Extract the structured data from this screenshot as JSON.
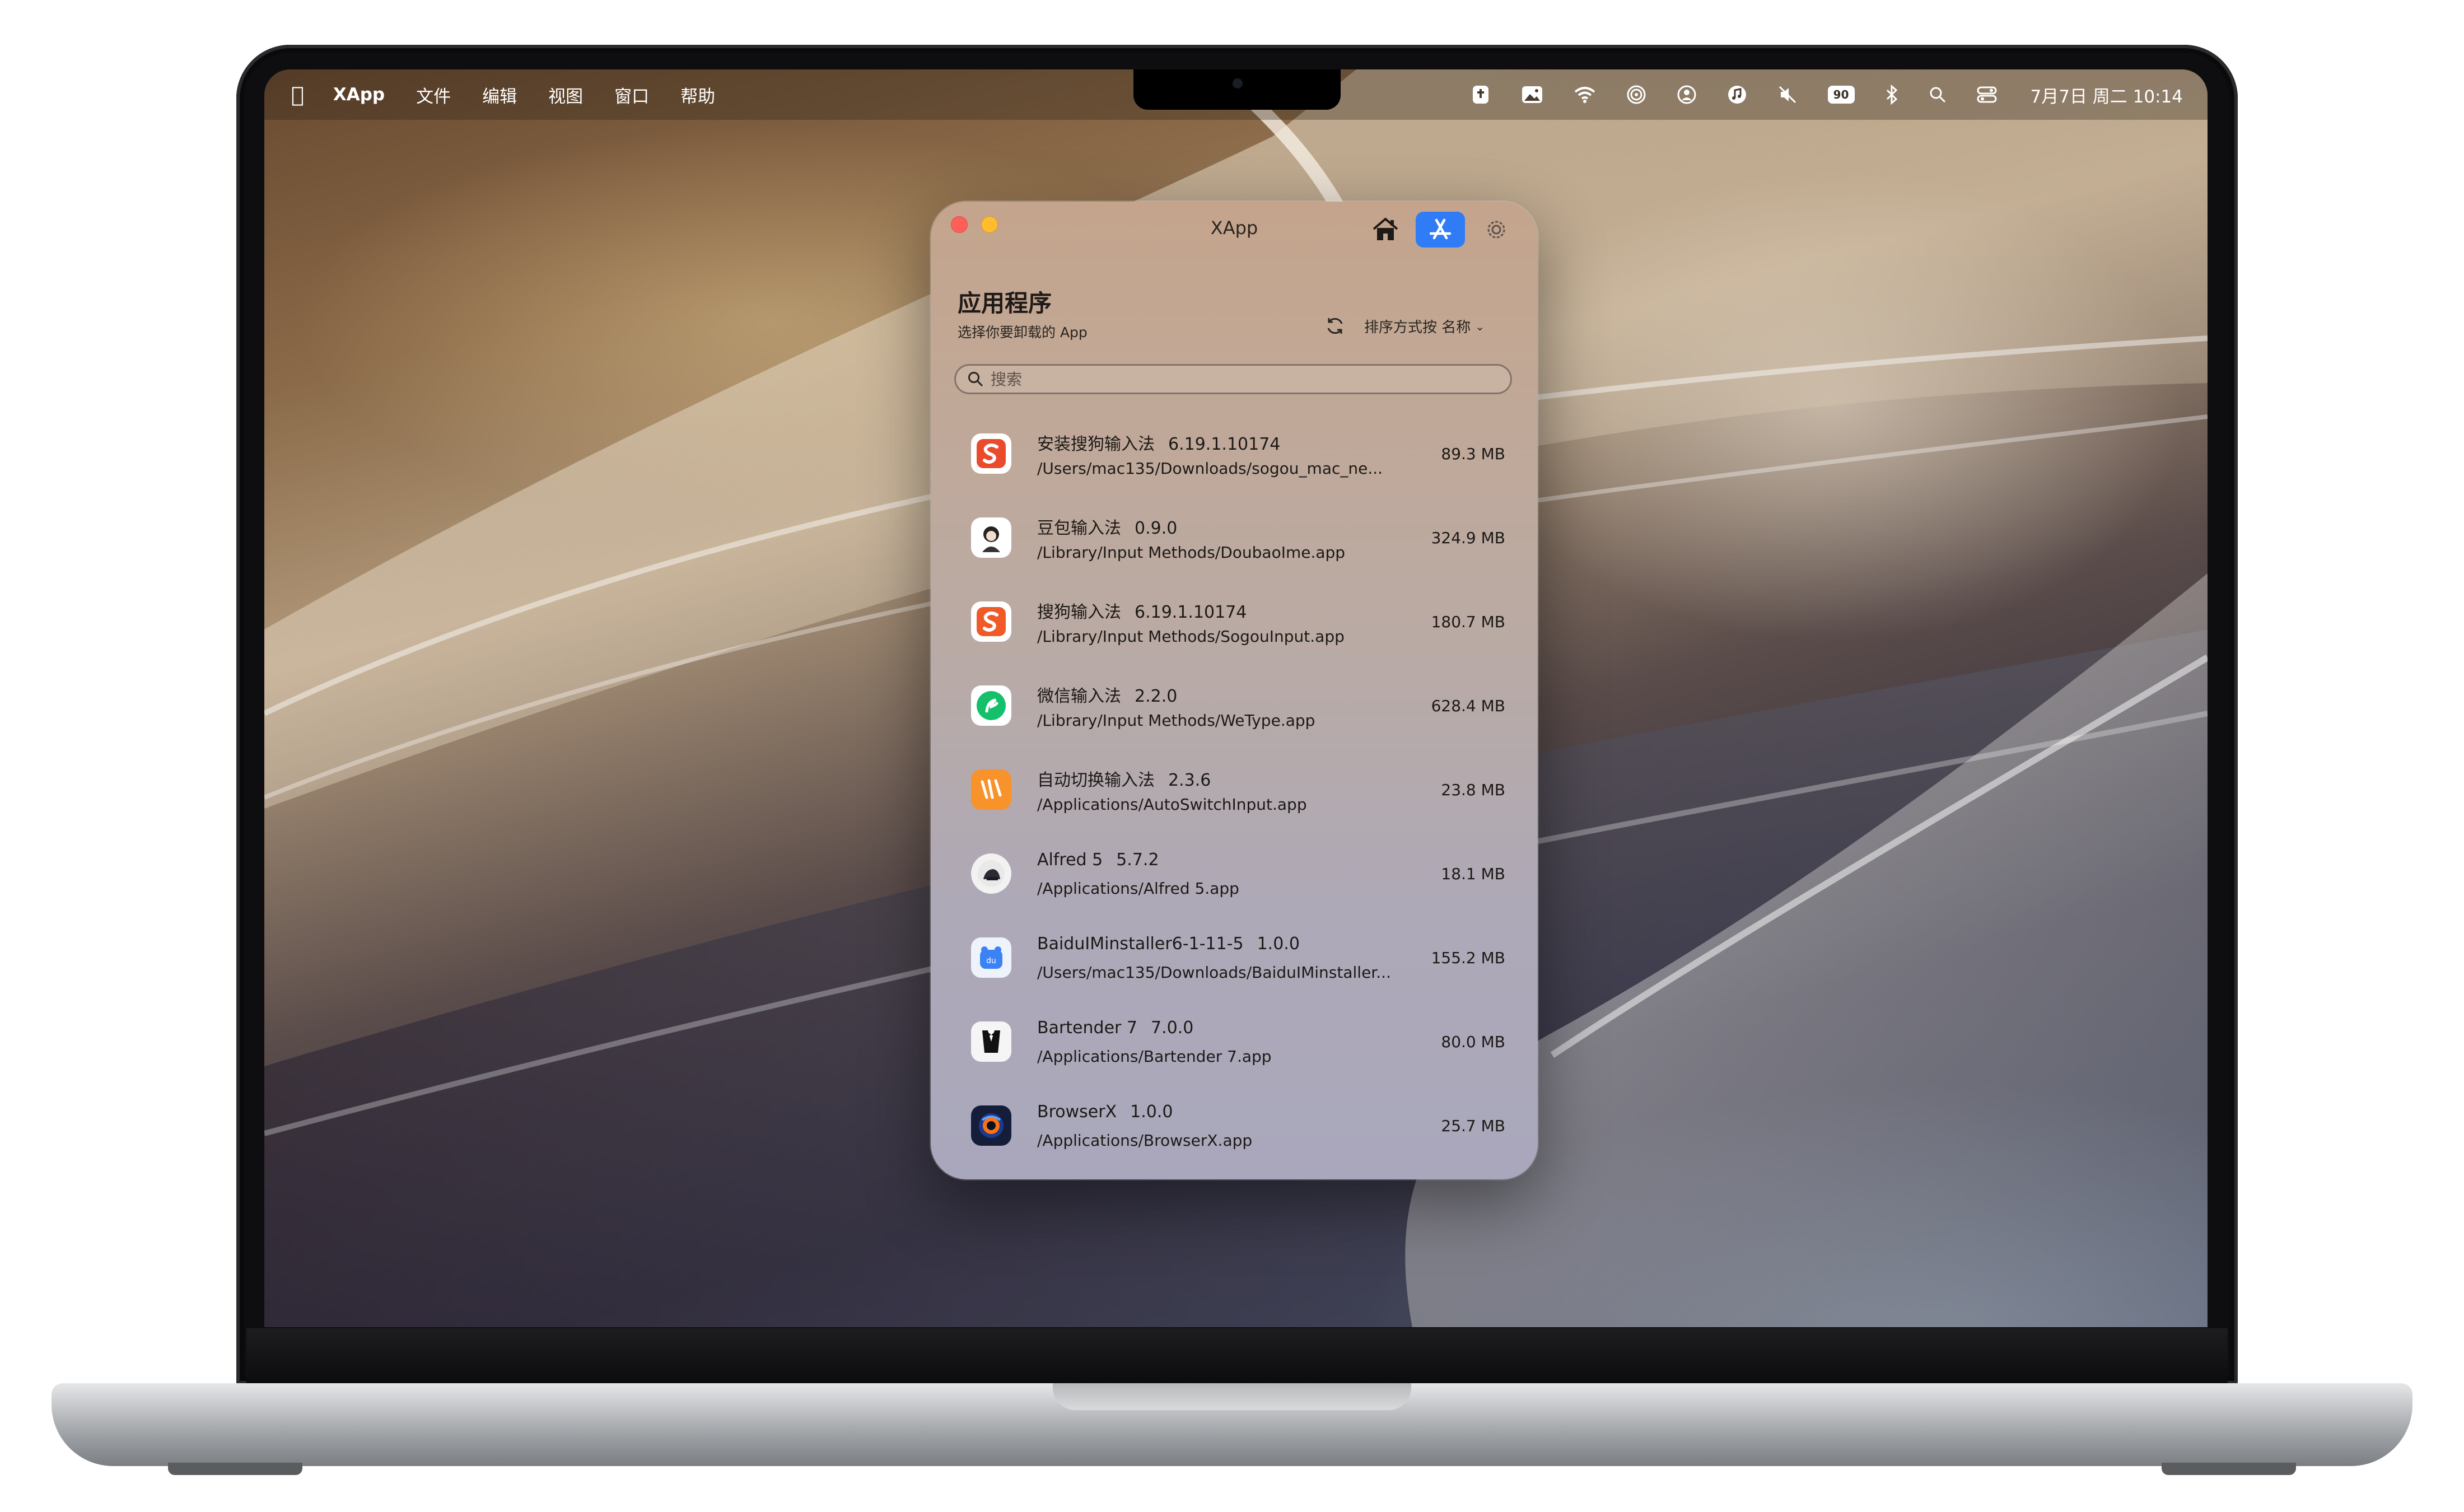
{
  "menubar": {
    "app_name": "XApp",
    "menus": [
      "文件",
      "编辑",
      "视图",
      "窗口",
      "帮助"
    ],
    "battery": "90",
    "clock": "7月7日 周二  10:14"
  },
  "window": {
    "title": "XApp",
    "section_title": "应用程序",
    "section_subtitle": "选择你要卸载的 App",
    "sort_label": "排序方式按 名称",
    "search_placeholder": "搜索"
  },
  "apps": [
    {
      "name": "安装搜狗输入法",
      "version": "6.19.1.10174",
      "path": "/Users/mac135/Downloads/sogou_mac_ne...",
      "size": "89.3 MB",
      "icon": "sogou-install-icon",
      "color": "#ea4b2c"
    },
    {
      "name": "豆包输入法",
      "version": "0.9.0",
      "path": "/Library/Input Methods/DoubaoIme.app",
      "size": "324.9 MB",
      "icon": "doubao-icon",
      "color": "#ffffff"
    },
    {
      "name": "搜狗输入法",
      "version": "6.19.1.10174",
      "path": "/Library/Input Methods/SogouInput.app",
      "size": "180.7 MB",
      "icon": "sogou-icon",
      "color": "#f05a28"
    },
    {
      "name": "微信输入法",
      "version": "2.2.0",
      "path": "/Library/Input Methods/WeType.app",
      "size": "628.4 MB",
      "icon": "wetype-icon",
      "color": "#15c06b"
    },
    {
      "name": "自动切换输入法",
      "version": "2.3.6",
      "path": "/Applications/AutoSwitchInput.app",
      "size": "23.8 MB",
      "icon": "autoswitch-icon",
      "color": "#f8922a"
    },
    {
      "name": "Alfred 5",
      "version": "5.7.2",
      "path": "/Applications/Alfred 5.app",
      "size": "18.1 MB",
      "icon": "alfred-icon",
      "color": "#f2f2f2"
    },
    {
      "name": "BaiduIMinstaller6-1-11-5",
      "version": "1.0.0",
      "path": "/Users/mac135/Downloads/BaiduIMinstaller...",
      "size": "155.2 MB",
      "icon": "baidu-ime-icon",
      "color": "#3b82f6"
    },
    {
      "name": "Bartender 7",
      "version": "7.0.0",
      "path": "/Applications/Bartender 7.app",
      "size": "80.0 MB",
      "icon": "bartender-icon",
      "color": "#f5f5f5"
    },
    {
      "name": "BrowserX",
      "version": "1.0.0",
      "path": "/Applications/BrowserX.app",
      "size": "25.7 MB",
      "icon": "browserx-icon",
      "color": "#141d3a"
    }
  ]
}
